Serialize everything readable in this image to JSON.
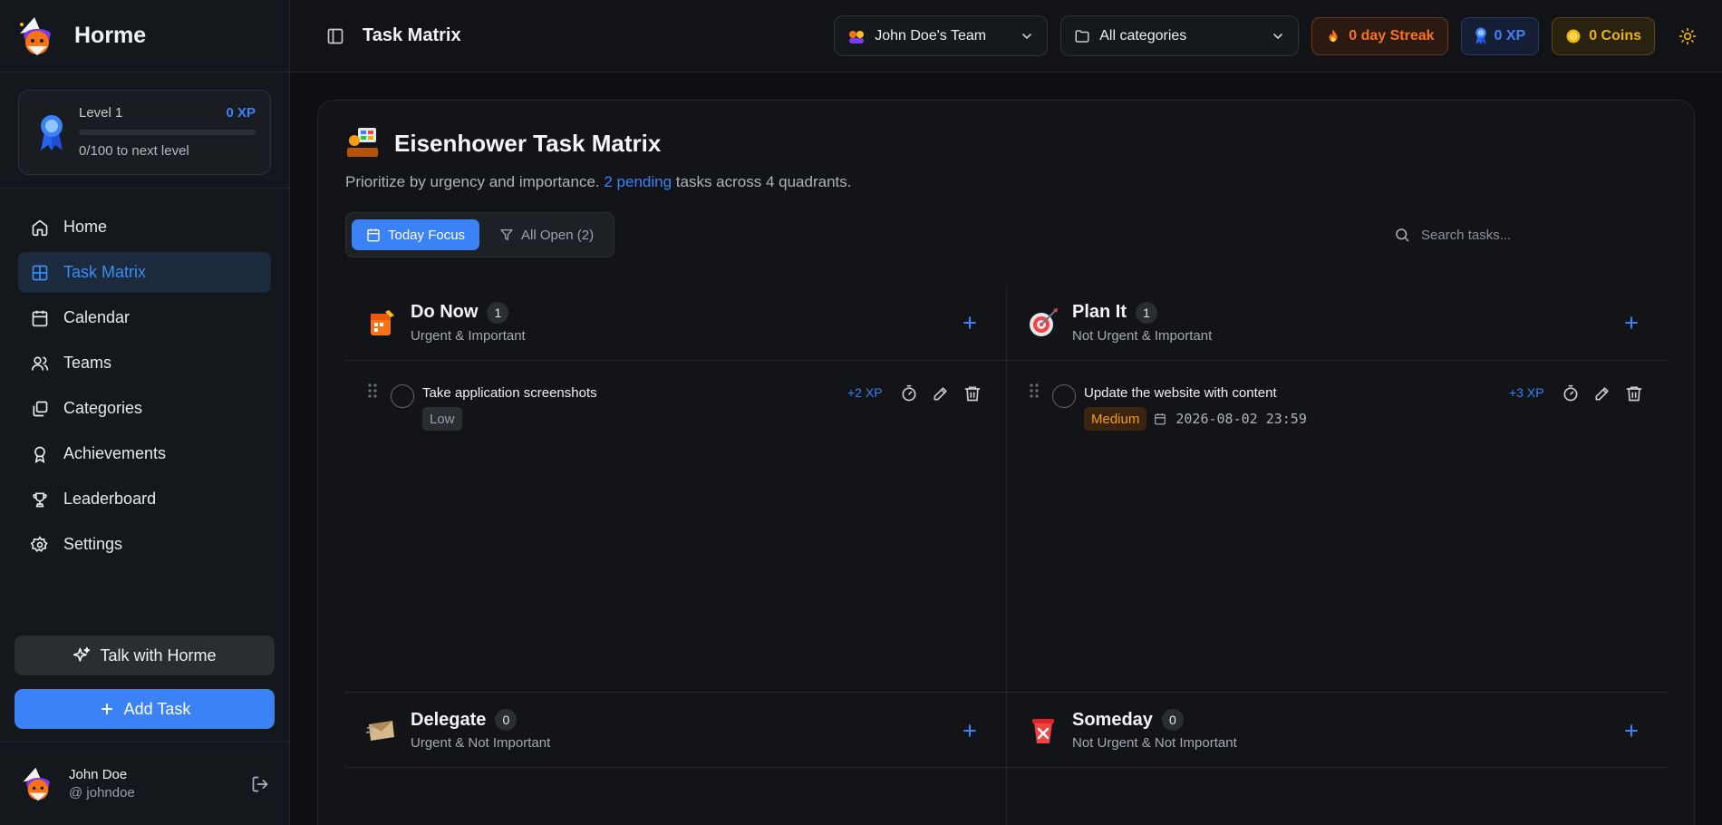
{
  "brand": {
    "name": "Horme"
  },
  "level": {
    "label": "Level 1",
    "xp": "0 XP",
    "progress_text": "0/100 to next level",
    "progress": 0
  },
  "nav": {
    "items": [
      {
        "label": "Home",
        "icon": "home-icon",
        "active": false
      },
      {
        "label": "Task Matrix",
        "icon": "grid-icon",
        "active": true
      },
      {
        "label": "Calendar",
        "icon": "calendar-icon",
        "active": false
      },
      {
        "label": "Teams",
        "icon": "users-icon",
        "active": false
      },
      {
        "label": "Categories",
        "icon": "layers-icon",
        "active": false
      },
      {
        "label": "Achievements",
        "icon": "award-icon",
        "active": false
      },
      {
        "label": "Leaderboard",
        "icon": "trophy-icon",
        "active": false
      },
      {
        "label": "Settings",
        "icon": "gear-icon",
        "active": false
      }
    ]
  },
  "sidebar_actions": {
    "talk": "Talk with Horme",
    "add_task": "Add Task"
  },
  "user": {
    "name": "John Doe",
    "handle": "@ johndoe"
  },
  "topbar": {
    "title": "Task Matrix",
    "team": "John Doe's Team",
    "category": "All categories",
    "streak": "0 day Streak",
    "xp": "0 XP",
    "coins": "0 Coins"
  },
  "panel": {
    "title": "Eisenhower Task Matrix",
    "subtitle_pre": "Prioritize by urgency and importance. ",
    "subtitle_hl": "2 pending",
    "subtitle_post": " tasks across 4 quadrants.",
    "tab_today": "Today Focus",
    "tab_all": "All Open (2)",
    "search_placeholder": "Search tasks..."
  },
  "quadrants": {
    "do_now": {
      "title": "Do Now",
      "count": "1",
      "subtitle": "Urgent & Important"
    },
    "plan_it": {
      "title": "Plan It",
      "count": "1",
      "subtitle": "Not Urgent & Important"
    },
    "delegate": {
      "title": "Delegate",
      "count": "0",
      "subtitle": "Urgent & Not Important"
    },
    "someday": {
      "title": "Someday",
      "count": "0",
      "subtitle": "Not Urgent & Not Important"
    }
  },
  "tasks": {
    "t1": {
      "title": "Take application screenshots",
      "priority": "Low",
      "xp": "+2 XP"
    },
    "t2": {
      "title": "Update the website with content",
      "priority": "Medium",
      "due": "2026-08-02 23:59",
      "xp": "+3 XP"
    }
  },
  "colors": {
    "accent": "#3b82f6",
    "streak": "#f97316",
    "coins": "#eab308",
    "medium": "#f59e0b"
  }
}
